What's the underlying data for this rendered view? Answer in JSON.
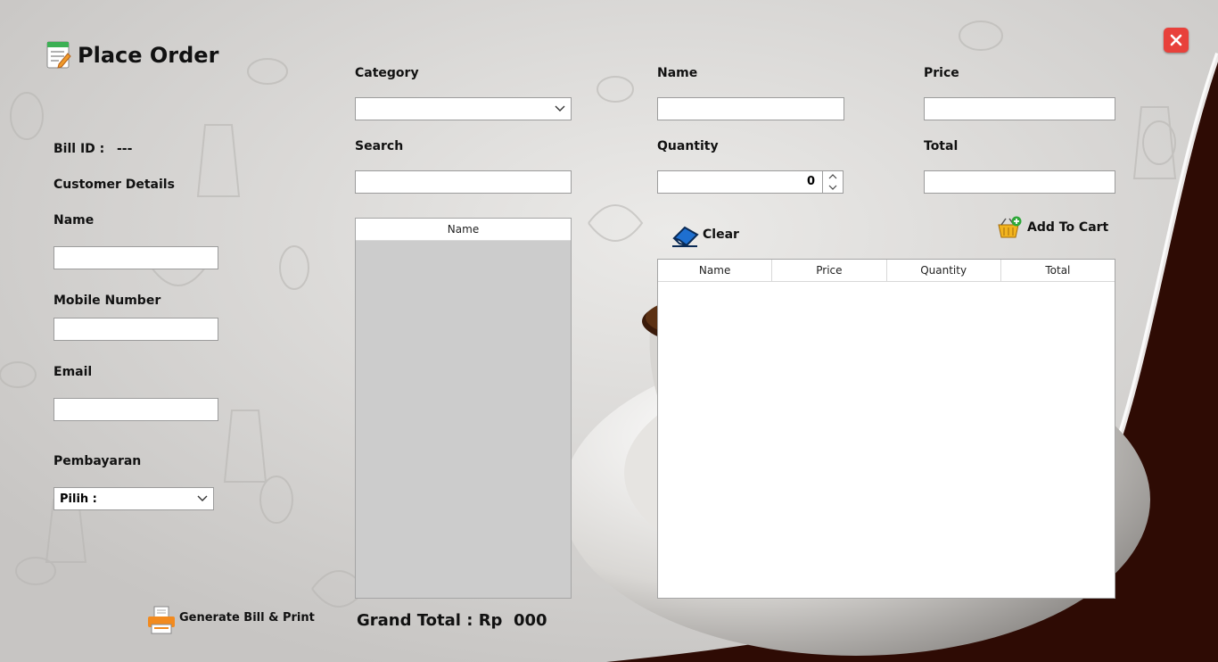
{
  "window": {
    "title": "Place Order"
  },
  "order": {
    "bill_id_label": "Bill ID :",
    "bill_id_value": "---",
    "customer_details_label": "Customer Details",
    "name_label": "Name",
    "name_value": "",
    "mobile_label": "Mobile Number",
    "mobile_value": "",
    "email_label": "Email",
    "email_value": "",
    "payment_label": "Pembayaran",
    "payment_selected": "Pilih :"
  },
  "product": {
    "category_label": "Category",
    "category_selected": "",
    "search_label": "Search",
    "search_value": "",
    "list_header": "Name",
    "items": []
  },
  "item": {
    "name_label": "Name",
    "name_value": "",
    "price_label": "Price",
    "price_value": "",
    "quantity_label": "Quantity",
    "quantity_value": "0",
    "total_label": "Total",
    "total_value": ""
  },
  "actions": {
    "clear_label": "Clear",
    "add_to_cart_label": "Add To Cart",
    "generate_bill_label": "Generate Bill & Print"
  },
  "cart": {
    "columns": [
      "Name",
      "Price",
      "Quantity",
      "Total"
    ],
    "rows": []
  },
  "grand_total": {
    "label": "Grand Total :",
    "currency": "Rp",
    "value": "000"
  },
  "colors": {
    "background": "#cfcdcb",
    "dark_wave": "#2e0b04",
    "close_button": "#e8413b",
    "list_fill": "#cccccc"
  },
  "icons": {
    "title": "order-form-icon",
    "close": "close-icon",
    "clear": "eraser-icon",
    "add_to_cart": "basket-add-icon",
    "generate_bill": "printer-icon"
  }
}
